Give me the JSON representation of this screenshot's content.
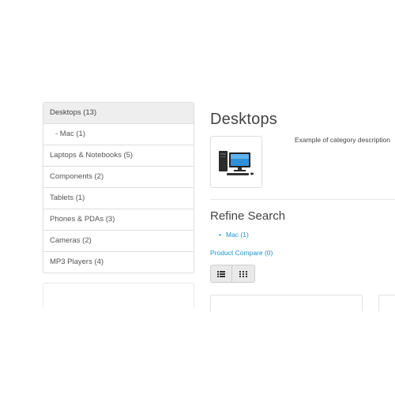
{
  "sidebar": {
    "items": [
      {
        "label": "Desktops (13)"
      },
      {
        "label": "- Mac (1)"
      },
      {
        "label": "Laptops & Notebooks (5)"
      },
      {
        "label": "Components (2)"
      },
      {
        "label": "Tablets (1)"
      },
      {
        "label": "Phones & PDAs (3)"
      },
      {
        "label": "Cameras (2)"
      },
      {
        "label": "MP3 Players (4)"
      }
    ]
  },
  "main": {
    "title": "Desktops",
    "category_image_icon": "desktop-computer-icon",
    "description": "Example of category description",
    "refine_title": "Refine Search",
    "refine_items": [
      {
        "label": "Mac (1)"
      }
    ],
    "compare_link": "Product Compare (0)",
    "view_buttons": {
      "list_icon": "list-view-icon",
      "grid_icon": "grid-view-icon"
    }
  },
  "colors": {
    "link": "#1e91cf",
    "active_bg": "#eeeeee",
    "border": "#dcdcdc",
    "button_bg": "#e9e9e9"
  }
}
